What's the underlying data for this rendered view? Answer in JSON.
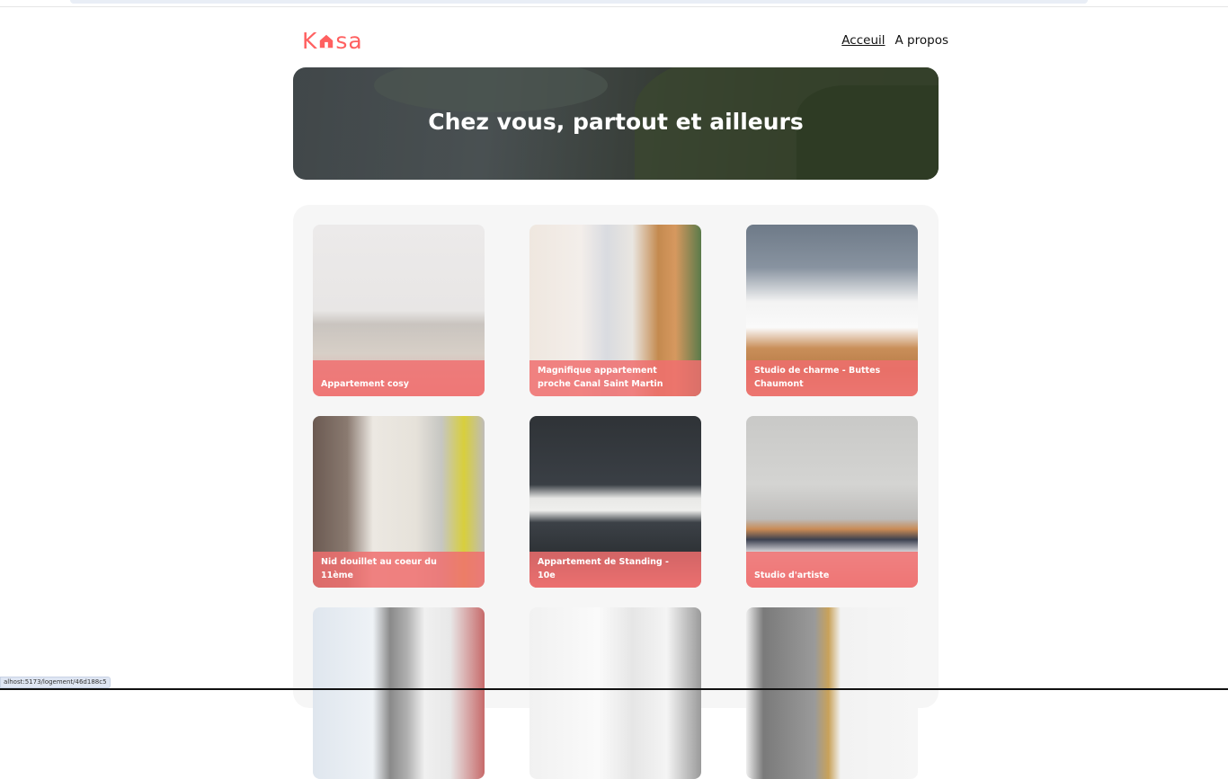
{
  "header": {
    "logo_left": "K",
    "logo_right": "sa",
    "logo_color": "#ff6060",
    "nav": [
      {
        "label": "Acceuil",
        "active": true
      },
      {
        "label": "A propos",
        "active": false
      }
    ]
  },
  "banner": {
    "title": "Chez vous, partout et ailleurs"
  },
  "cards": [
    {
      "title": "Appartement cosy"
    },
    {
      "title": "Magnifique appartement proche Canal Saint Martin"
    },
    {
      "title": "Studio de charme - Buttes Chaumont"
    },
    {
      "title": "Nid douillet au coeur du 11ème"
    },
    {
      "title": "Appartement de Standing - 10e"
    },
    {
      "title": "Studio d'artiste"
    },
    {
      "title": ""
    },
    {
      "title": ""
    },
    {
      "title": ""
    }
  ],
  "status_url": "alhost:5173/logement/46d188c5"
}
